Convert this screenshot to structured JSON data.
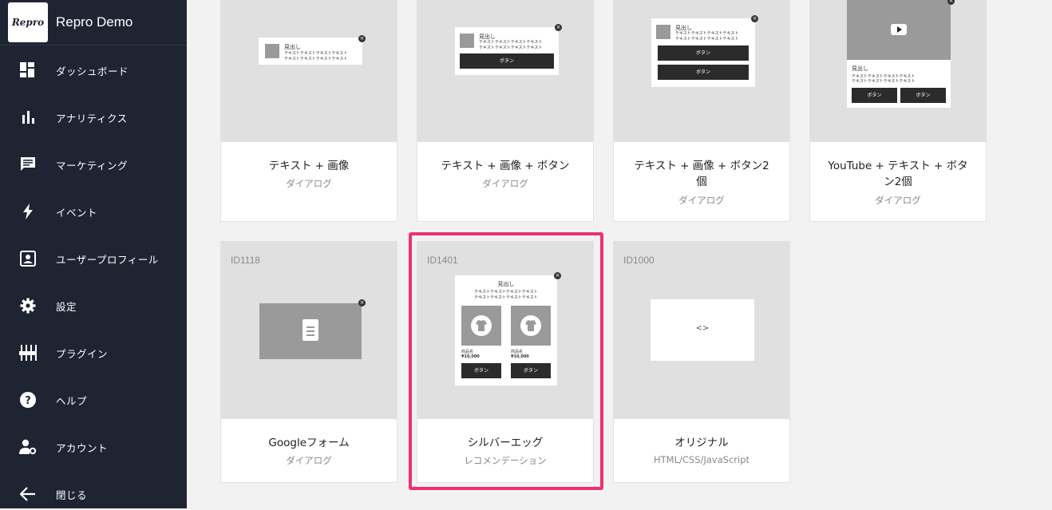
{
  "brand": {
    "logo_text": "Repro",
    "name": "Repro Demo"
  },
  "nav": [
    {
      "label": "ダッシュボード",
      "icon": "dashboard-icon"
    },
    {
      "label": "アナリティクス",
      "icon": "bar-chart-icon"
    },
    {
      "label": "マーケティング",
      "icon": "chat-icon"
    },
    {
      "label": "イベント",
      "icon": "bolt-icon"
    },
    {
      "label": "ユーザープロフィール",
      "icon": "profile-icon"
    },
    {
      "label": "設定",
      "icon": "gear-icon"
    },
    {
      "label": "プラグイン",
      "icon": "plugin-icon"
    },
    {
      "label": "ヘルプ",
      "icon": "help-icon"
    },
    {
      "label": "アカウント",
      "icon": "account-settings-icon"
    },
    {
      "label": "閉じる",
      "icon": "arrow-left-icon"
    }
  ],
  "cards": [
    {
      "id": "",
      "title": "テキスト + 画像",
      "subtitle": "ダイアログ"
    },
    {
      "id": "",
      "title": "テキスト + 画像 + ボタン",
      "subtitle": "ダイアログ"
    },
    {
      "id": "",
      "title": "テキスト + 画像 + ボタン2",
      "title2": "個",
      "subtitle": "ダイアログ"
    },
    {
      "id": "",
      "title": "YouTube + テキスト + ボタ",
      "title2": "ン2個",
      "subtitle": "ダイアログ"
    },
    {
      "id": "ID1118",
      "title": "Googleフォーム",
      "subtitle": "ダイアログ"
    },
    {
      "id": "ID1401",
      "title": "シルバーエッグ",
      "subtitle": "レコメンデーション"
    },
    {
      "id": "ID1000",
      "title": "オリジナル",
      "subtitle": "HTML/CSS/JavaScript"
    }
  ],
  "preview_text": {
    "heading": "見出し",
    "body1": "テキストテキストテキストテキスト",
    "body2": "テキストテキストテキストテキスト",
    "button": "ボタン",
    "product_name": "商品名",
    "price": "¥10,000",
    "code": "<>"
  },
  "colors": {
    "sidebar": "#1f2433",
    "highlight": "#f0306e",
    "background": "#f2f2f2"
  }
}
